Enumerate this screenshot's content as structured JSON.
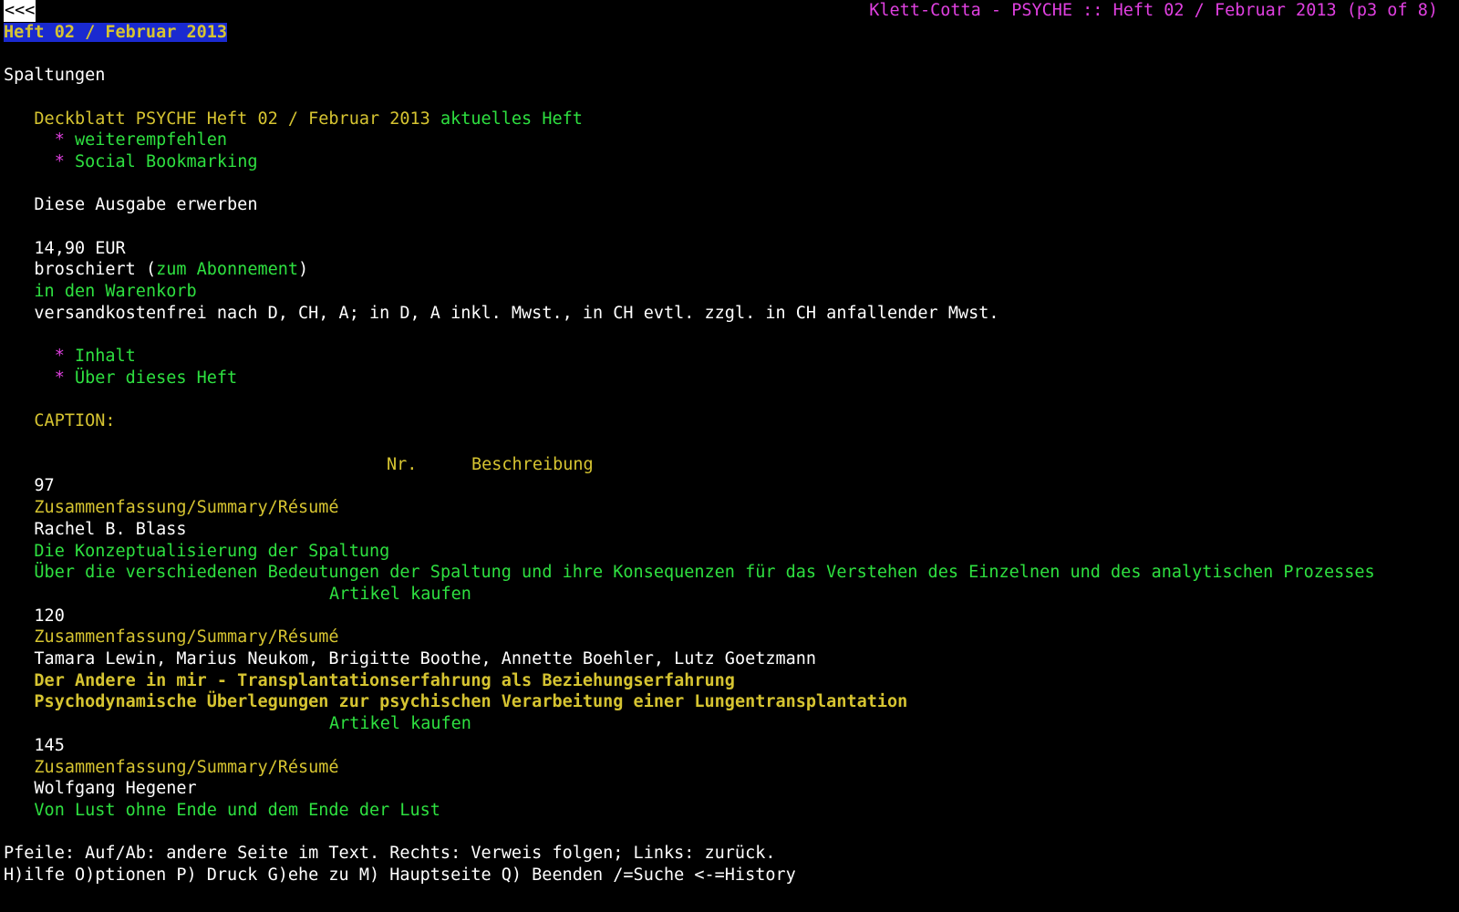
{
  "top_bar": {
    "back_label": "<<<",
    "window_title": "Klett-Cotta - PSYCHE :: Heft 02 / Februar 2013 (p3 of 8)"
  },
  "page": {
    "highlighted_heading": "Heft 02 / Februar 2013",
    "section_title": "Spaltungen"
  },
  "cover": {
    "link_text": "Deckblatt PSYCHE Heft 02 / Februar 2013",
    "current_issue_label": "aktuelles Heft",
    "bullet": "*",
    "bullet_links": [
      "weiterempfehlen",
      "Social Bookmarking"
    ]
  },
  "purchase": {
    "heading": "Diese Ausgabe erwerben",
    "price": "14,90 EUR",
    "binding_prefix": "broschiert (",
    "subscription_link": "zum Abonnement",
    "binding_suffix": ")",
    "cart_link": "in den Warenkorb",
    "shipping_note": "versandkostenfrei nach D, CH, A; in D, A inkl. Mwst., in CH evtl. zzgl. in CH anfallender Mwst."
  },
  "issue_nav": {
    "bullet": "*",
    "links": [
      "Inhalt",
      "Über dieses Heft"
    ]
  },
  "table": {
    "caption": "CAPTION:",
    "headers": [
      "Nr.",
      "Beschreibung"
    ],
    "summary_label": "Zusammenfassung/Summary/Résumé",
    "buy_label": "Artikel kaufen",
    "articles": [
      {
        "nr": "97",
        "authors": "Rachel B. Blass",
        "title": "Die Konzeptualisierung der Spaltung",
        "subtitle": "Über die verschiedenen Bedeutungen der Spaltung und ihre Konsequenzen für das Verstehen des Einzelnen und des analytischen Prozesses"
      },
      {
        "nr": "120",
        "authors": "Tamara Lewin, Marius Neukom, Brigitte Boothe, Annette Boehler, Lutz Goetzmann",
        "title": "Der Andere in mir - Transplantationserfahrung als Beziehungserfahrung",
        "subtitle": "Psychodynamische Überlegungen zur psychischen Verarbeitung einer Lungentransplantation"
      },
      {
        "nr": "145",
        "authors": "Wolfgang Hegener",
        "title": "Von Lust ohne Ende und dem Ende der Lust"
      }
    ]
  },
  "status": {
    "help_line": "Pfeile: Auf/Ab: andere Seite im Text. Rechts: Verweis folgen; Links: zurück.",
    "commands_line": "H)ilfe O)ptionen P) Druck G)ehe zu M) Hauptseite Q) Beenden /=Suche <-=History"
  },
  "colors": {
    "background": "#000000",
    "text": "#ffffff",
    "link": "#2ee040",
    "heading": "#d6c431",
    "bullet": "#e040e0",
    "highlight": "#1a2ad0"
  }
}
